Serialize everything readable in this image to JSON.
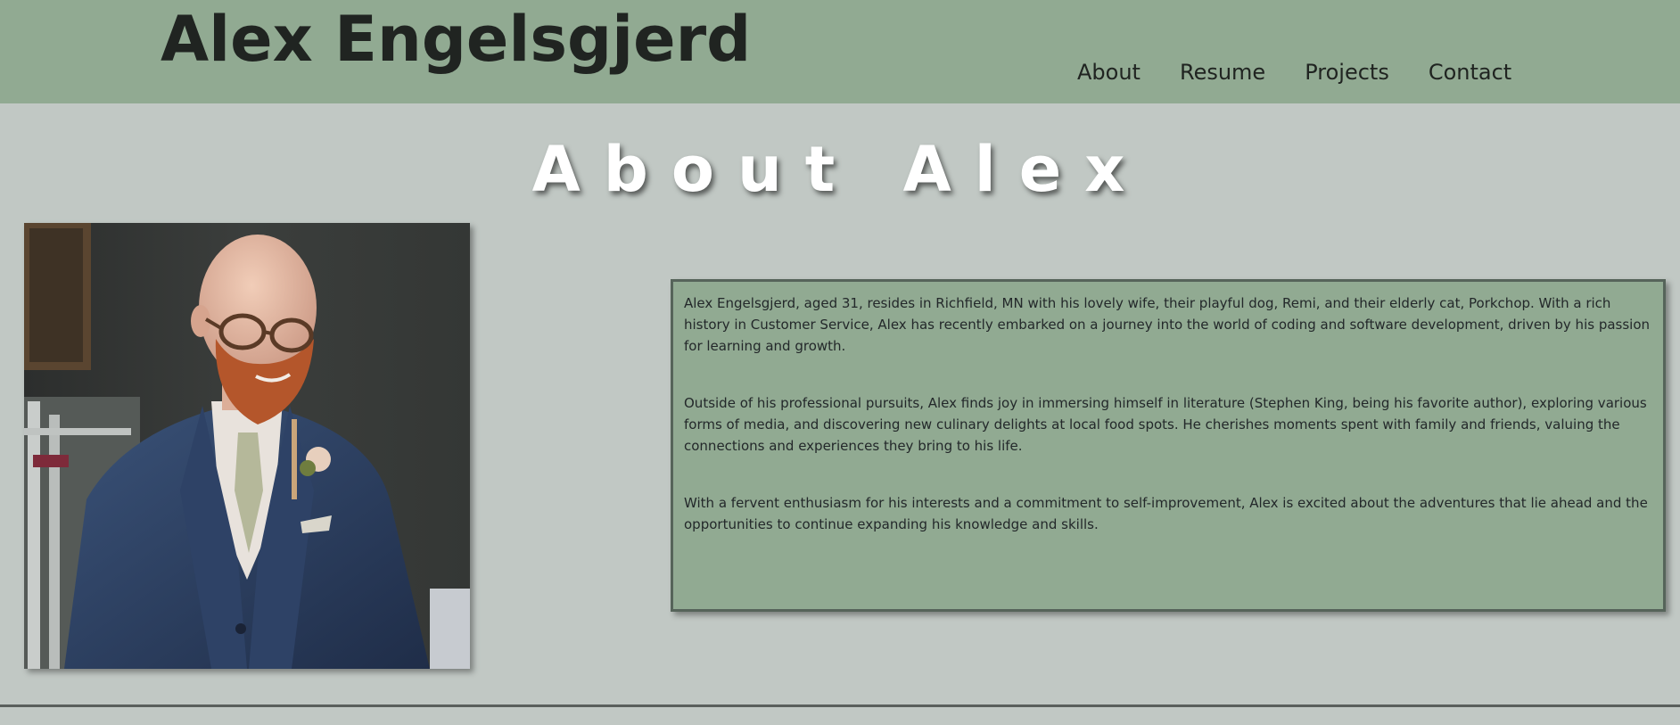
{
  "header": {
    "site_title": "Alex Engelsgjerd",
    "nav": [
      "About",
      "Resume",
      "Projects",
      "Contact"
    ]
  },
  "main": {
    "heading": "About Alex",
    "photo_alt": "Alex Engelsgjerd",
    "bio": [
      "Alex Engelsgjerd, aged 31, resides in Richfield, MN with his lovely wife, their playful dog, Remi, and their elderly cat, Porkchop. With a rich history in Customer Service, Alex has recently embarked on a journey into the world of coding and software development, driven by his passion for learning and growth.",
      "Outside of his professional pursuits, Alex finds joy in immersing himself in literature (Stephen King, being his favorite author), exploring various forms of media, and discovering new culinary delights at local food spots. He cherishes moments spent with family and friends, valuing the connections and experiences they bring to his life.",
      "With a fervent enthusiasm for his interests and a commitment to self-improvement, Alex is excited about the adventures that lie ahead and the opportunities to continue expanding his knowledge and skills."
    ]
  },
  "colors": {
    "header_bg": "#91aa92",
    "page_bg": "#c1c8c4",
    "bio_bg": "#91aa92",
    "bio_border": "#56645a",
    "text": "#202421"
  }
}
